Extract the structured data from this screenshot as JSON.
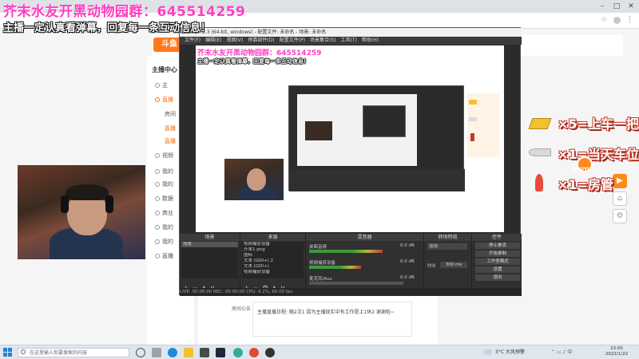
{
  "overlays": {
    "line1": "芥末水友开黑动物园群：645514259",
    "line2": "主播一定认真看弹幕，回复每一条互动信息！"
  },
  "browser": {
    "window_controls": [
      "–",
      "□",
      "✕"
    ],
    "toolbar_icons": [
      "star-icon",
      "profile-icon",
      "menu-icon"
    ]
  },
  "site": {
    "logo": "斗鱼",
    "sidebar_title": "主播中心",
    "sidebar_items": [
      "主",
      "直播",
      "房间",
      "直播",
      "直播",
      "视频",
      "我的",
      "我的",
      "数据",
      "商业",
      "我的",
      "我的",
      "直播"
    ],
    "announce_label": "房间公告",
    "announce_text": "主播直播日程: 随2次1 因为主播现实中有工作是上1休2 谢谢啦~"
  },
  "obs": {
    "title": "OBS 27.1.3 (64-bit, windows) - 配置文件: 未命名 - 场景: 未命名",
    "menu": [
      "文件(F)",
      "编辑(E)",
      "视图(V)",
      "停靠部件(D)",
      "配置文件(P)",
      "场景集合(S)",
      "工具(T)",
      "帮助(H)"
    ],
    "docks": {
      "scenes_title": "场景",
      "sources_title": "来源",
      "mixer_title": "混音器",
      "transitions_title": "转场特效",
      "controls_title": "控件"
    },
    "scenes": [
      "场景"
    ],
    "sources": [
      "视频捕获设备",
      "芥末1 png",
      "图标",
      "文本 (GDI+) 2",
      "文本 (GDI+)",
      "视频捕获设备"
    ],
    "mixer": [
      {
        "label": "桌面音频",
        "db": "0.0 dB",
        "level": 0.78
      },
      {
        "label": "视频捕获设备",
        "db": "0.0 dB",
        "level": 0.55
      },
      {
        "label": "麦克风/Aux",
        "db": "0.0 dB",
        "level": 0.0
      }
    ],
    "transition": {
      "type": "淡出",
      "duration_label": "时长",
      "duration": "300 ms"
    },
    "controls": [
      "停止推流",
      "开始录制",
      "工作室模式",
      "设置",
      "退出"
    ],
    "status": "LIVE: 00:00:00    REC: 00:00:00    CPU: 9.2%, 60.00 fps"
  },
  "promo": {
    "line1": "×5=上车一把",
    "line2": "×1=当天车位",
    "line3": "×1=房管",
    "badge_logo": "DOUYU"
  },
  "side_tools": [
    "▶",
    "⌂",
    "⚙"
  ],
  "taskbar": {
    "search_placeholder": "在这里输入你要搜索的内容",
    "weather": "3°C 大风预警",
    "time": "23:00",
    "date": "2022/1/22"
  },
  "colors": {
    "overlay_pink": "#ff3ec0",
    "douyu_orange": "#ff7a1a",
    "obs_dark": "#2b2b2b"
  }
}
